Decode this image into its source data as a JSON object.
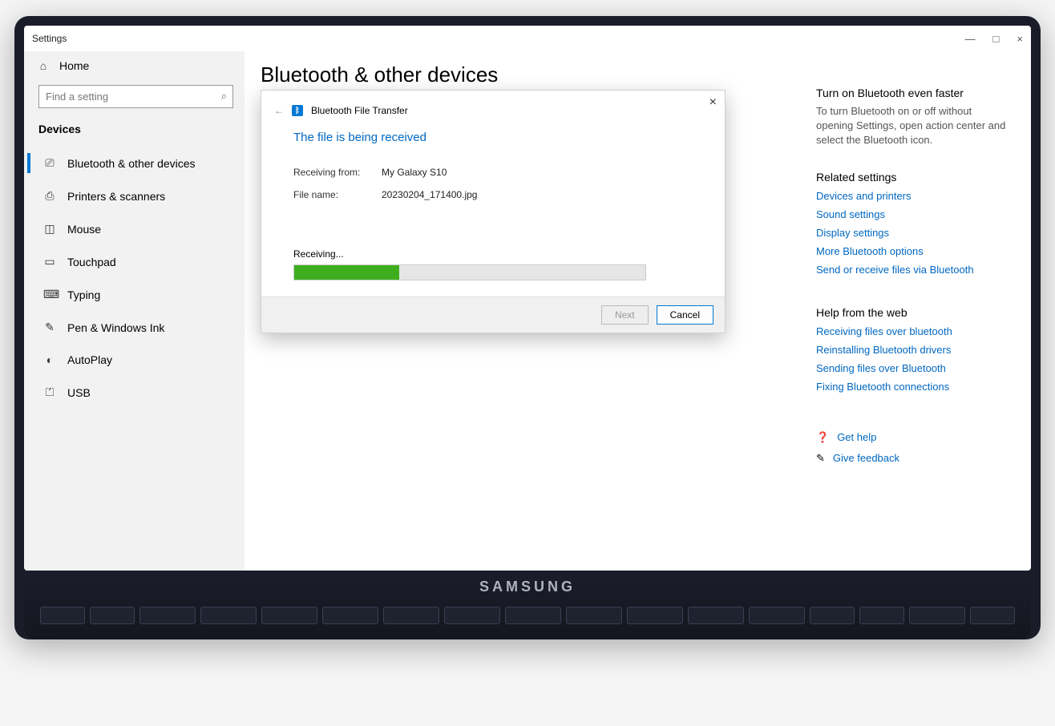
{
  "window": {
    "title": "Settings",
    "minimize": "—",
    "maximize": "□",
    "close": "×"
  },
  "sidebar": {
    "home": "Home",
    "searchPlaceholder": "Find a setting",
    "heading": "Devices",
    "items": [
      {
        "label": "Bluetooth & other devices",
        "icon": "⎚",
        "active": true
      },
      {
        "label": "Printers & scanners",
        "icon": "⎙",
        "active": false
      },
      {
        "label": "Mouse",
        "icon": "◫",
        "active": false
      },
      {
        "label": "Touchpad",
        "icon": "▭",
        "active": false
      },
      {
        "label": "Typing",
        "icon": "⌨",
        "active": false
      },
      {
        "label": "Pen & Windows Ink",
        "icon": "✎",
        "active": false
      },
      {
        "label": "AutoPlay",
        "icon": "◐",
        "active": false
      },
      {
        "label": "USB",
        "icon": "⏍",
        "active": false
      }
    ]
  },
  "page": {
    "title": "Bluetooth & other devices"
  },
  "dialog": {
    "headerTitle": "Bluetooth File Transfer",
    "title": "The file is being received",
    "receivingFromLabel": "Receiving from:",
    "receivingFromValue": "My Galaxy S10",
    "fileNameLabel": "File name:",
    "fileNameValue": "20230204_171400.jpg",
    "progressLabel": "Receiving...",
    "progressPercent": 30,
    "nextBtn": "Next",
    "cancelBtn": "Cancel",
    "close": "×"
  },
  "rightPane": {
    "tip": {
      "head": "Turn on Bluetooth even faster",
      "body": "To turn Bluetooth on or off without opening Settings, open action center and select the Bluetooth icon."
    },
    "related": {
      "head": "Related settings",
      "links": [
        "Devices and printers",
        "Sound settings",
        "Display settings",
        "More Bluetooth options",
        "Send or receive files via Bluetooth"
      ]
    },
    "help": {
      "head": "Help from the web",
      "links": [
        "Receiving files over bluetooth",
        "Reinstalling Bluetooth drivers",
        "Sending files over Bluetooth",
        "Fixing Bluetooth connections"
      ]
    },
    "bottom": {
      "getHelp": "Get help",
      "feedback": "Give feedback"
    }
  },
  "laptop": {
    "brand": "SAMSUNG"
  }
}
